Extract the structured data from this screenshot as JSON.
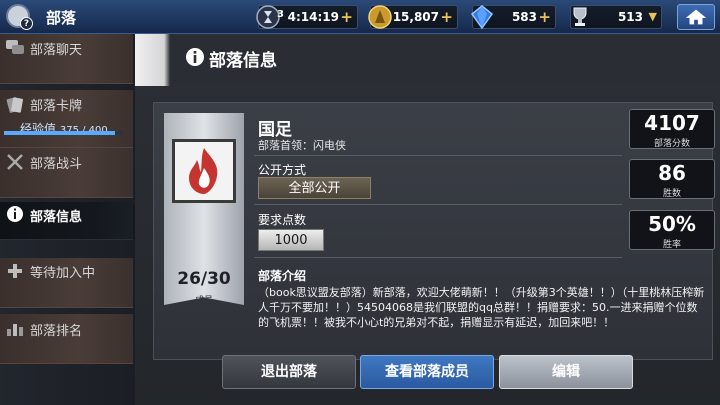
{
  "topbar": {
    "title": "部落",
    "timer_badge": "3",
    "timer": "4:14:19",
    "gold": "15,807",
    "gems": "583",
    "trophies": "513",
    "colors": {
      "plus": "#e9c35a",
      "bar": "#1f3a66"
    },
    "icons": [
      "clan-logo-icon",
      "hourglass-icon",
      "gold-coin-icon",
      "gem-icon",
      "trophy-icon",
      "home-icon"
    ]
  },
  "sidebar": {
    "items": [
      {
        "label": "部落聊天",
        "icon": "chat-icon"
      },
      {
        "label": "部落卡牌",
        "icon": "cards-icon",
        "xp_label": "经验值",
        "xp_value": "375 / 400",
        "xp_fraction": 0.9375
      },
      {
        "label": "部落战斗",
        "icon": "crossed-swords-icon"
      },
      {
        "label": "部落信息",
        "icon": "info-icon",
        "active": true
      },
      {
        "label": "等待加入中",
        "icon": "plus-icon"
      },
      {
        "label": "部落排名",
        "icon": "ranking-icon"
      }
    ]
  },
  "main": {
    "title": "部落信息",
    "clan": {
      "name": "国足",
      "leader": "部落首领：闪电侠",
      "members": "26/30",
      "members_label": "成员",
      "badge_icon": "flame-badge-icon"
    },
    "fields": {
      "mode_label": "公开方式",
      "mode_value": "全部公开",
      "req_label": "要求点数",
      "req_value": "1000"
    },
    "stats": [
      {
        "value": "4107",
        "caption": "部落分数"
      },
      {
        "value": "86",
        "caption": "胜数"
      },
      {
        "value": "50%",
        "caption": "胜率"
      }
    ],
    "intro": {
      "title": "部落介绍",
      "text": "（book思议盟友部落）新部落，欢迎大佬萌新！！（升级第3个英雄！！）（十里桃林压榨新人千万不要加！！）54504068是我们联盟的qq总群！！捐赠要求：50.一进来捐赠个位数的飞机票！！被我不小心t的兄弟对不起，捐赠显示有延迟，加回来吧！！"
    },
    "buttons": {
      "leave": "退出部落",
      "members": "查看部落成员",
      "edit": "编辑"
    }
  }
}
